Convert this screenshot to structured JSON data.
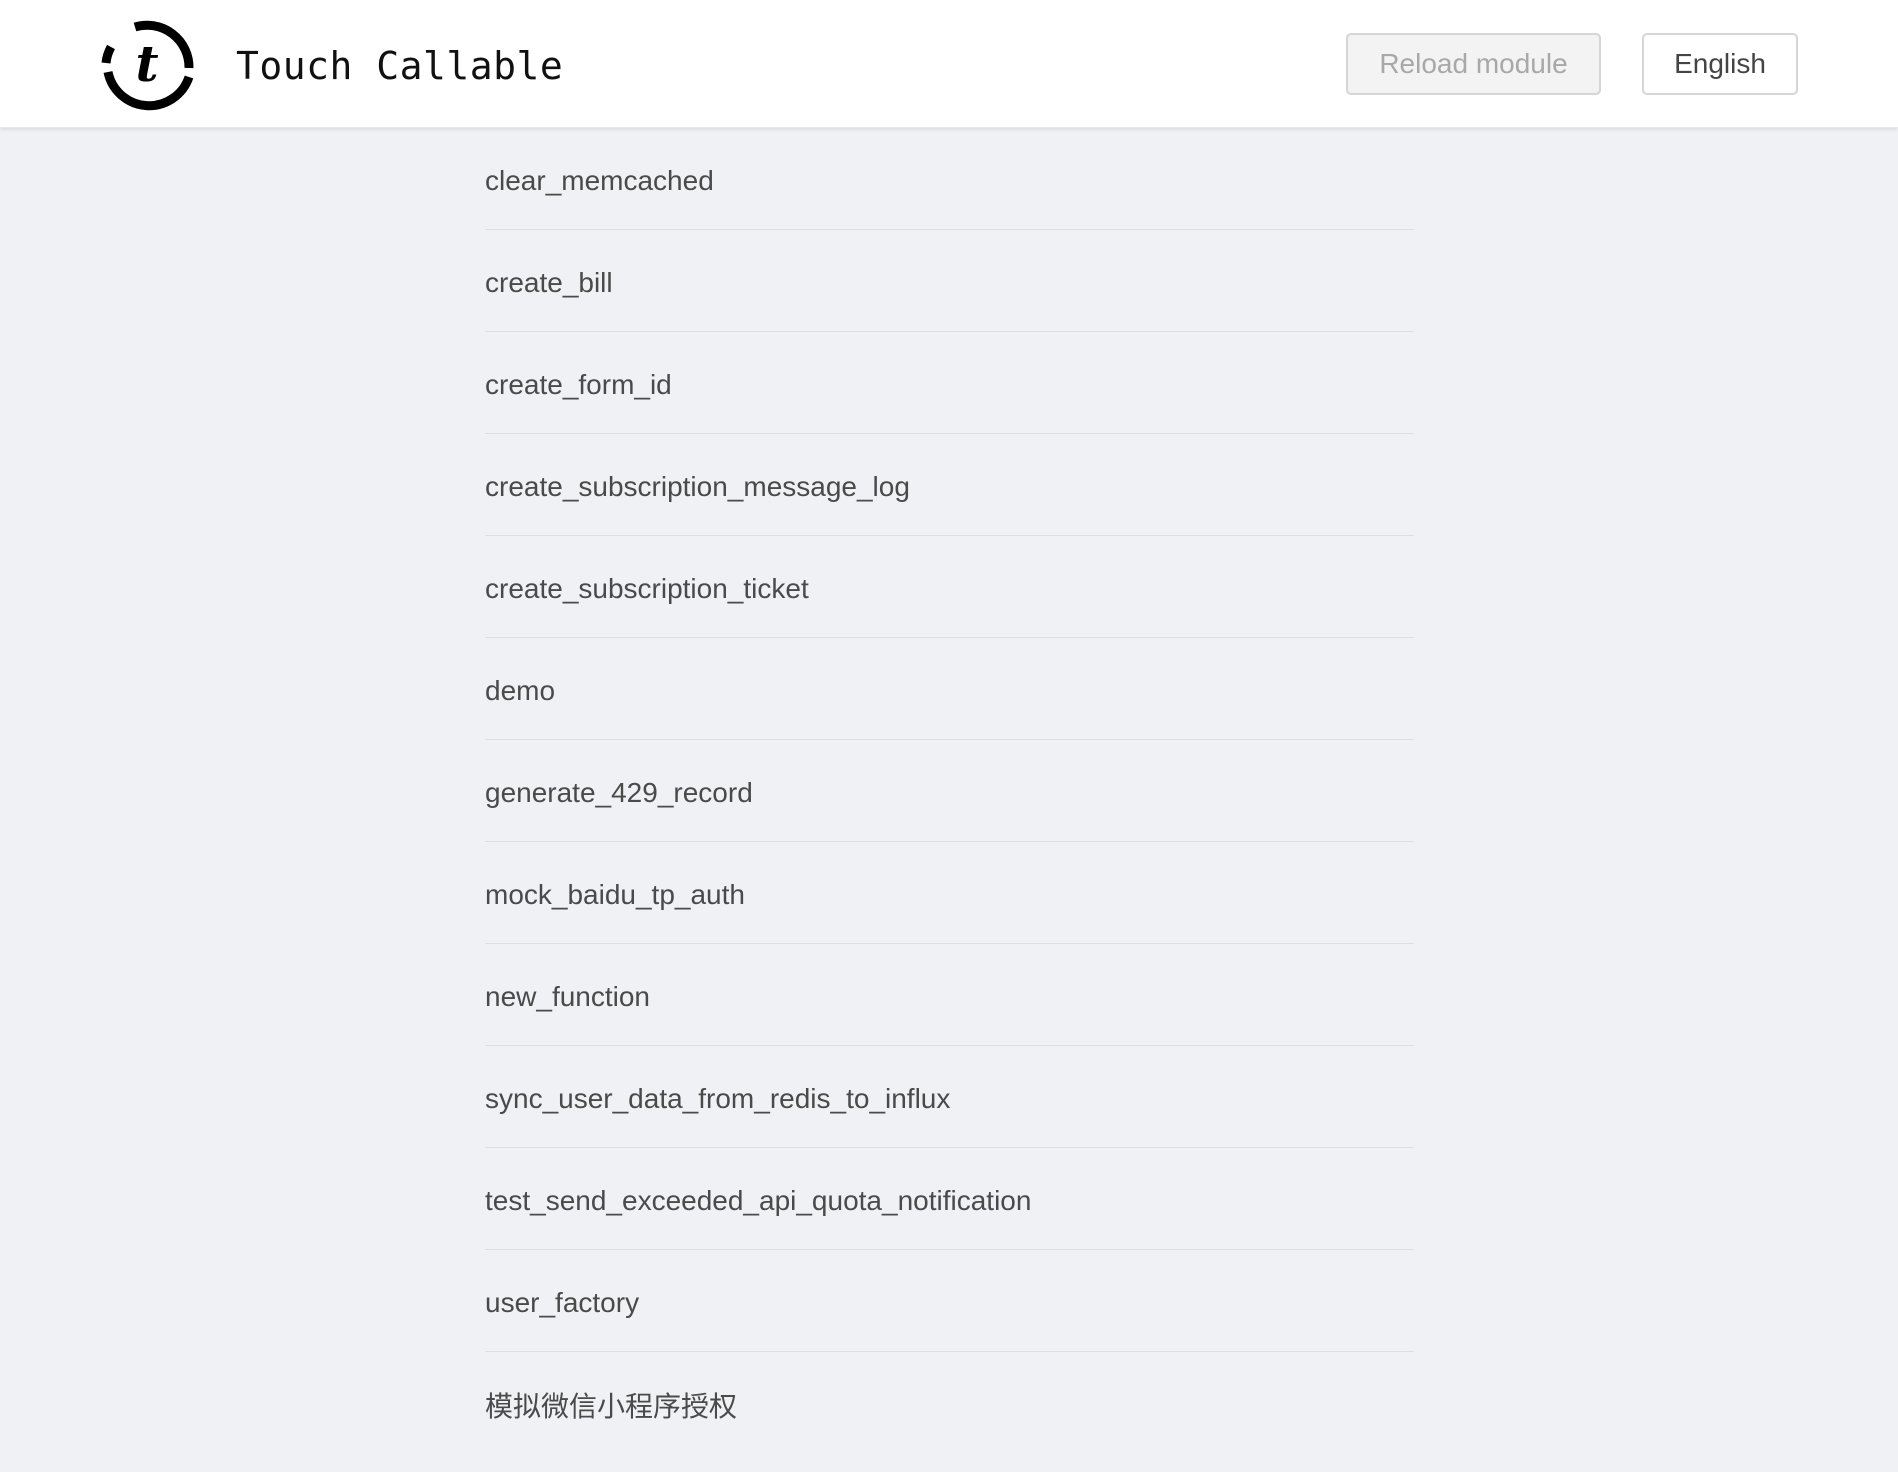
{
  "header": {
    "title": "Touch Callable",
    "logo_icon": "touch-callable-logo-icon",
    "reload_label": "Reload module",
    "language_label": "English"
  },
  "functions": [
    "clear_memcached",
    "create_bill",
    "create_form_id",
    "create_subscription_message_log",
    "create_subscription_ticket",
    "demo",
    "generate_429_record",
    "mock_baidu_tp_auth",
    "new_function",
    "sync_user_data_from_redis_to_influx",
    "test_send_exceeded_api_quota_notification",
    "user_factory",
    "模拟微信小程序授权"
  ],
  "colors": {
    "background": "#f0f1f5",
    "header": "#ffffff",
    "text": "#4a4a4a",
    "divider": "#dedfe3",
    "disabled_text": "#a8a8a8"
  }
}
